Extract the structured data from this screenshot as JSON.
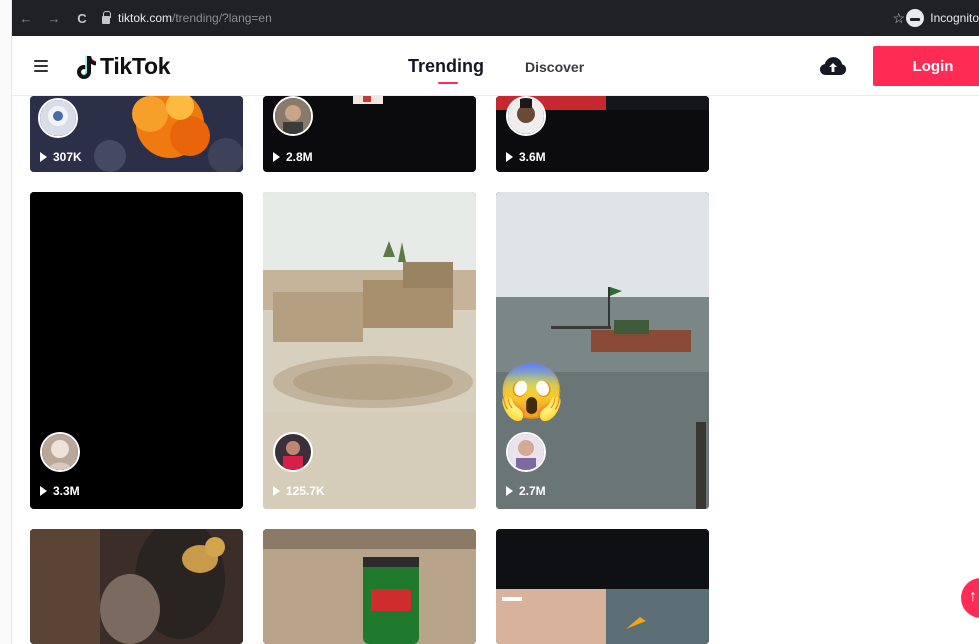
{
  "browser": {
    "back_icon": "←",
    "forward_icon": "→",
    "reload_icon": "C",
    "url_host": "tiktok.com",
    "url_path": "/trending/?lang=en",
    "star_icon": "☆",
    "incognito_label": "Incognito"
  },
  "header": {
    "logo_text": "TikTok",
    "tab_trending": "Trending",
    "tab_discover": "Discover",
    "login_label": "Login"
  },
  "videos": [
    {
      "views": "307K"
    },
    {
      "views": "2.8M"
    },
    {
      "views": "3.6M"
    },
    {
      "views": "3.3M"
    },
    {
      "views": "125.7K"
    },
    {
      "views": "2.7M"
    }
  ],
  "emoji": {
    "shocked": "😱"
  },
  "colors": {
    "accent": "#fe2c55",
    "chrome_bg": "#202124"
  }
}
